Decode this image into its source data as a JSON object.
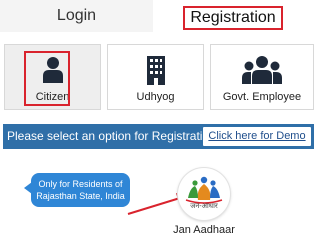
{
  "tabs": {
    "login": "Login",
    "registration": "Registration"
  },
  "cards": [
    {
      "label": "Citizen",
      "icon": "person-icon"
    },
    {
      "label": "Udhyog",
      "icon": "building-icon"
    },
    {
      "label": "Govt. Employee",
      "icon": "group-icon"
    }
  ],
  "registration_bar": {
    "text": "Please select an option for Registration",
    "demo_link": "Click here for Demo"
  },
  "callout": {
    "text": "Only for Residents of Rajasthan State, India"
  },
  "jan_aadhaar": {
    "logo_text": "जन-आधार",
    "label": "Jan Aadhaar"
  },
  "colors": {
    "highlight_red": "#d9232d",
    "bar_blue": "#2f6fa8",
    "callout_blue": "#2f86d6",
    "icon_dark": "#1f2a3a"
  }
}
